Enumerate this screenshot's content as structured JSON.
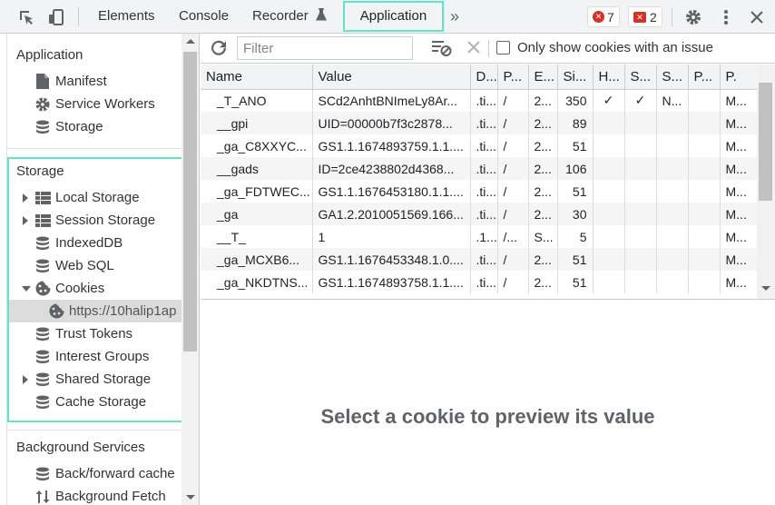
{
  "tabs": {
    "elements": "Elements",
    "console": "Console",
    "recorder": "Recorder",
    "application": "Application",
    "more": "»"
  },
  "badges": {
    "errors": "7",
    "issues": "2"
  },
  "sidebar": {
    "application_title": "Application",
    "application_items": [
      "Manifest",
      "Service Workers",
      "Storage"
    ],
    "storage_title": "Storage",
    "storage_items": [
      "Local Storage",
      "Session Storage",
      "IndexedDB",
      "Web SQL",
      "Cookies",
      "https://10halip1ap",
      "Trust Tokens",
      "Interest Groups",
      "Shared Storage",
      "Cache Storage"
    ],
    "background_title": "Background Services",
    "background_items": [
      "Back/forward cache",
      "Background Fetch"
    ]
  },
  "cookies_toolbar": {
    "filter_placeholder": "Filter",
    "only_issues_label": "Only show cookies with an issue"
  },
  "table": {
    "headers": [
      "Name",
      "Value",
      "D...",
      "P...",
      "E...",
      "Si...",
      "H...",
      "S...",
      "S...",
      "P...",
      "P."
    ],
    "rows": [
      [
        "_T_ANO",
        "SCd2AnhtBNImeLy8Ar...",
        ".ti...",
        "/",
        "2...",
        "350",
        "✓",
        "✓",
        "N...",
        "",
        "M..."
      ],
      [
        "__gpi",
        "UID=00000b7f3c2878...",
        ".ti...",
        "/",
        "2...",
        "89",
        "",
        "",
        "",
        "",
        "M..."
      ],
      [
        "_ga_C8XXYC...",
        "GS1.1.1674893759.1.1....",
        ".ti...",
        "/",
        "2...",
        "51",
        "",
        "",
        "",
        "",
        "M..."
      ],
      [
        "__gads",
        "ID=2ce4238802d4368...",
        ".ti...",
        "/",
        "2...",
        "106",
        "",
        "",
        "",
        "",
        "M..."
      ],
      [
        "_ga_FDTWEC...",
        "GS1.1.1676453180.1.1....",
        ".ti...",
        "/",
        "2...",
        "51",
        "",
        "",
        "",
        "",
        "M..."
      ],
      [
        "_ga",
        "GA1.2.2010051569.166...",
        ".ti...",
        "/",
        "2...",
        "30",
        "",
        "",
        "",
        "",
        "M..."
      ],
      [
        "__T_",
        "1",
        ".1...",
        "/...",
        "S...",
        "5",
        "",
        "",
        "",
        "",
        "M..."
      ],
      [
        "_ga_MCXB6...",
        "GS1.1.1676453348.1.0....",
        ".ti...",
        "/",
        "2...",
        "51",
        "",
        "",
        "",
        "",
        "M..."
      ],
      [
        "_ga_NKDTNS...",
        "GS1.1.1674893758.1.1....",
        ".ti...",
        "/",
        "2...",
        "51",
        "",
        "",
        "",
        "",
        "M..."
      ]
    ]
  },
  "preview_text": "Select a cookie to preview its value",
  "colors": {
    "highlight": "#5ee6c9",
    "error": "#d93025"
  }
}
